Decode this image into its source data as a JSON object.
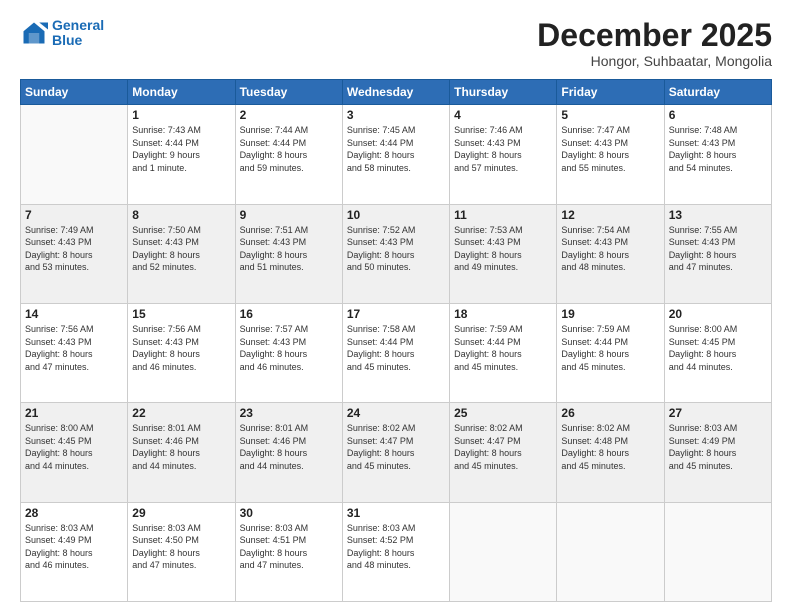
{
  "logo": {
    "line1": "General",
    "line2": "Blue"
  },
  "header": {
    "month": "December 2025",
    "location": "Hongor, Suhbaatar, Mongolia"
  },
  "days_of_week": [
    "Sunday",
    "Monday",
    "Tuesday",
    "Wednesday",
    "Thursday",
    "Friday",
    "Saturday"
  ],
  "weeks": [
    [
      {
        "day": "",
        "info": ""
      },
      {
        "day": "1",
        "info": "Sunrise: 7:43 AM\nSunset: 4:44 PM\nDaylight: 9 hours\nand 1 minute."
      },
      {
        "day": "2",
        "info": "Sunrise: 7:44 AM\nSunset: 4:44 PM\nDaylight: 8 hours\nand 59 minutes."
      },
      {
        "day": "3",
        "info": "Sunrise: 7:45 AM\nSunset: 4:44 PM\nDaylight: 8 hours\nand 58 minutes."
      },
      {
        "day": "4",
        "info": "Sunrise: 7:46 AM\nSunset: 4:43 PM\nDaylight: 8 hours\nand 57 minutes."
      },
      {
        "day": "5",
        "info": "Sunrise: 7:47 AM\nSunset: 4:43 PM\nDaylight: 8 hours\nand 55 minutes."
      },
      {
        "day": "6",
        "info": "Sunrise: 7:48 AM\nSunset: 4:43 PM\nDaylight: 8 hours\nand 54 minutes."
      }
    ],
    [
      {
        "day": "7",
        "info": "Sunrise: 7:49 AM\nSunset: 4:43 PM\nDaylight: 8 hours\nand 53 minutes."
      },
      {
        "day": "8",
        "info": "Sunrise: 7:50 AM\nSunset: 4:43 PM\nDaylight: 8 hours\nand 52 minutes."
      },
      {
        "day": "9",
        "info": "Sunrise: 7:51 AM\nSunset: 4:43 PM\nDaylight: 8 hours\nand 51 minutes."
      },
      {
        "day": "10",
        "info": "Sunrise: 7:52 AM\nSunset: 4:43 PM\nDaylight: 8 hours\nand 50 minutes."
      },
      {
        "day": "11",
        "info": "Sunrise: 7:53 AM\nSunset: 4:43 PM\nDaylight: 8 hours\nand 49 minutes."
      },
      {
        "day": "12",
        "info": "Sunrise: 7:54 AM\nSunset: 4:43 PM\nDaylight: 8 hours\nand 48 minutes."
      },
      {
        "day": "13",
        "info": "Sunrise: 7:55 AM\nSunset: 4:43 PM\nDaylight: 8 hours\nand 47 minutes."
      }
    ],
    [
      {
        "day": "14",
        "info": "Sunrise: 7:56 AM\nSunset: 4:43 PM\nDaylight: 8 hours\nand 47 minutes."
      },
      {
        "day": "15",
        "info": "Sunrise: 7:56 AM\nSunset: 4:43 PM\nDaylight: 8 hours\nand 46 minutes."
      },
      {
        "day": "16",
        "info": "Sunrise: 7:57 AM\nSunset: 4:43 PM\nDaylight: 8 hours\nand 46 minutes."
      },
      {
        "day": "17",
        "info": "Sunrise: 7:58 AM\nSunset: 4:44 PM\nDaylight: 8 hours\nand 45 minutes."
      },
      {
        "day": "18",
        "info": "Sunrise: 7:59 AM\nSunset: 4:44 PM\nDaylight: 8 hours\nand 45 minutes."
      },
      {
        "day": "19",
        "info": "Sunrise: 7:59 AM\nSunset: 4:44 PM\nDaylight: 8 hours\nand 45 minutes."
      },
      {
        "day": "20",
        "info": "Sunrise: 8:00 AM\nSunset: 4:45 PM\nDaylight: 8 hours\nand 44 minutes."
      }
    ],
    [
      {
        "day": "21",
        "info": "Sunrise: 8:00 AM\nSunset: 4:45 PM\nDaylight: 8 hours\nand 44 minutes."
      },
      {
        "day": "22",
        "info": "Sunrise: 8:01 AM\nSunset: 4:46 PM\nDaylight: 8 hours\nand 44 minutes."
      },
      {
        "day": "23",
        "info": "Sunrise: 8:01 AM\nSunset: 4:46 PM\nDaylight: 8 hours\nand 44 minutes."
      },
      {
        "day": "24",
        "info": "Sunrise: 8:02 AM\nSunset: 4:47 PM\nDaylight: 8 hours\nand 45 minutes."
      },
      {
        "day": "25",
        "info": "Sunrise: 8:02 AM\nSunset: 4:47 PM\nDaylight: 8 hours\nand 45 minutes."
      },
      {
        "day": "26",
        "info": "Sunrise: 8:02 AM\nSunset: 4:48 PM\nDaylight: 8 hours\nand 45 minutes."
      },
      {
        "day": "27",
        "info": "Sunrise: 8:03 AM\nSunset: 4:49 PM\nDaylight: 8 hours\nand 45 minutes."
      }
    ],
    [
      {
        "day": "28",
        "info": "Sunrise: 8:03 AM\nSunset: 4:49 PM\nDaylight: 8 hours\nand 46 minutes."
      },
      {
        "day": "29",
        "info": "Sunrise: 8:03 AM\nSunset: 4:50 PM\nDaylight: 8 hours\nand 47 minutes."
      },
      {
        "day": "30",
        "info": "Sunrise: 8:03 AM\nSunset: 4:51 PM\nDaylight: 8 hours\nand 47 minutes."
      },
      {
        "day": "31",
        "info": "Sunrise: 8:03 AM\nSunset: 4:52 PM\nDaylight: 8 hours\nand 48 minutes."
      },
      {
        "day": "",
        "info": ""
      },
      {
        "day": "",
        "info": ""
      },
      {
        "day": "",
        "info": ""
      }
    ]
  ]
}
